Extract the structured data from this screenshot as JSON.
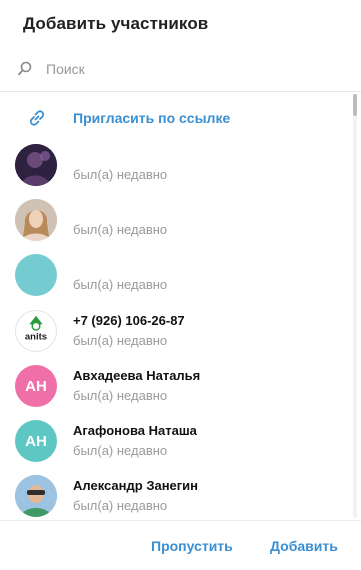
{
  "dialog": {
    "title": "Добавить участников",
    "search": {
      "placeholder": "Поиск",
      "value": "",
      "icon": "search-icon"
    },
    "invite": {
      "label": "Пригласить по ссылке",
      "icon": "link-icon",
      "color": "#3a8fd1"
    },
    "contacts": [
      {
        "name": "",
        "status": "был(а) недавно",
        "avatar": {
          "type": "photo",
          "bg": "#3b2f4f"
        }
      },
      {
        "name": "",
        "status": "был(а) недавно",
        "avatar": {
          "type": "photo",
          "bg": "#d7b9a0"
        }
      },
      {
        "name": "",
        "status": "был(а) недавно",
        "avatar": {
          "type": "solid",
          "bg": "#74cbd0"
        }
      },
      {
        "name": "+7 (926) 106-26-87",
        "status": "был(а) недавно",
        "avatar": {
          "type": "logo",
          "text": "anits"
        }
      },
      {
        "name": "Авхадеева Наталья",
        "status": "был(а) недавно",
        "avatar": {
          "type": "initials",
          "initials": "АН",
          "bg": "#ef6fa9"
        }
      },
      {
        "name": "Агафонова Наташа",
        "status": "был(а) недавно",
        "avatar": {
          "type": "initials",
          "initials": "АН",
          "bg": "#5ec7c4"
        }
      },
      {
        "name": "Александр Занегин",
        "status": "был(а) недавно",
        "avatar": {
          "type": "photo",
          "bg": "#7fb0d8"
        }
      }
    ],
    "buttons": {
      "skip": "Пропустить",
      "add": "Добавить"
    },
    "colors": {
      "accent": "#3a8fd1",
      "status_text": "#999999"
    }
  }
}
